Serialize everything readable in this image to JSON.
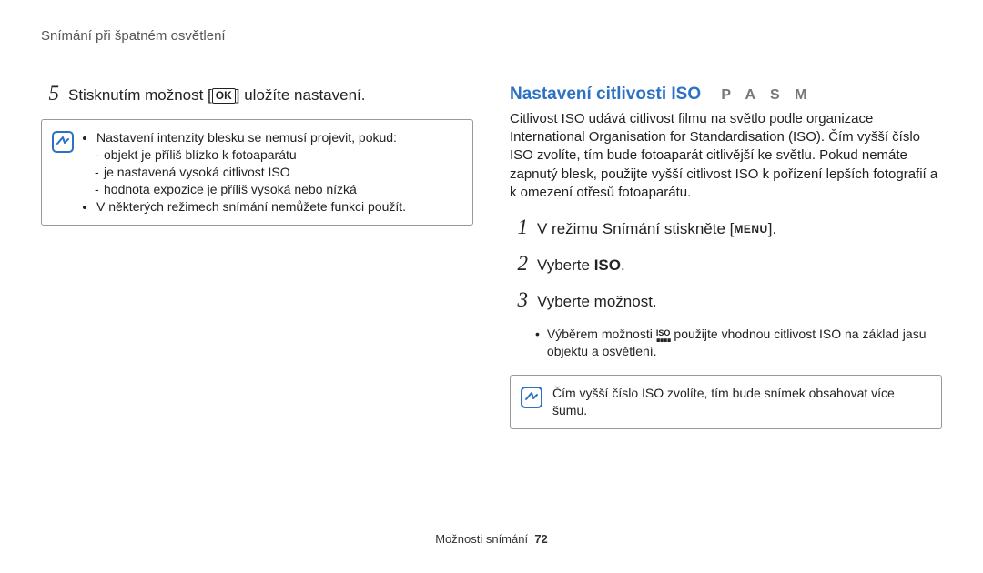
{
  "header": {
    "title": "Snímání při špatném osvětlení"
  },
  "left": {
    "step5_num": "5",
    "step5_pre": "Stisknutím možnost [",
    "step5_ok": "OK",
    "step5_post": "] uložíte nastavení.",
    "note": {
      "b1": "Nastavení intenzity blesku se nemusí projevit, pokud:",
      "s1": "objekt je příliš blízko k fotoaparátu",
      "s2": "je nastavená vysoká citlivost ISO",
      "s3": "hodnota expozice je příliš vysoká nebo nízká",
      "b2": "V některých režimech snímání nemůžete funkci použít."
    }
  },
  "right": {
    "heading": "Nastavení citlivosti ISO",
    "modes": "P A S M",
    "para": "Citlivost ISO udává citlivost filmu na světlo podle organizace International Organisation for Standardisation (ISO). Čím vyšší číslo ISO zvolíte, tím bude fotoaparát citlivější ke světlu. Pokud nemáte zapnutý blesk, použijte vyšší citlivost ISO k pořízení lepších fotografií a k omezení otřesů fotoaparátu.",
    "step1_num": "1",
    "step1_pre": "V režimu Snímání stiskněte [",
    "step1_menu": "MENU",
    "step1_post": "].",
    "step2_num": "2",
    "step2_pre": "Vyberte ",
    "step2_bold": "ISO",
    "step2_post": ".",
    "step3_num": "3",
    "step3_text": "Vyberte možnost.",
    "sub_pre": "Výběrem možnosti ",
    "sub_iso_top": "ISO",
    "sub_post": " použijte vhodnou citlivost ISO na základ jasu objektu a osvětlení.",
    "note": "Čím vyšší číslo ISO zvolíte, tím bude snímek obsahovat více šumu."
  },
  "footer": {
    "text": "Možnosti snímání",
    "page": "72"
  }
}
